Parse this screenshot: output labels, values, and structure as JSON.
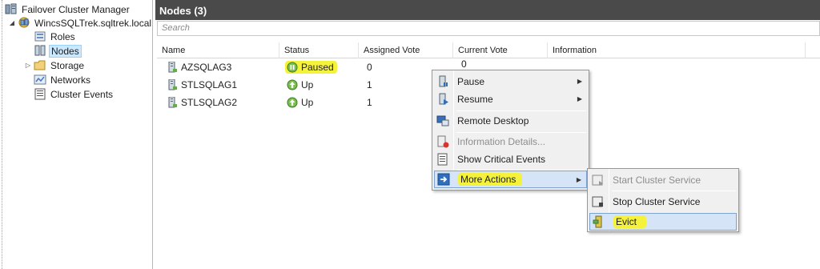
{
  "tree": {
    "root": "Failover Cluster Manager",
    "cluster": "WincsSQLTrek.sqltrek.local",
    "items": [
      "Roles",
      "Nodes",
      "Storage",
      "Networks",
      "Cluster Events"
    ]
  },
  "header": {
    "title": "Nodes (3)"
  },
  "search": {
    "placeholder": "Search"
  },
  "columns": [
    "Name",
    "Status",
    "Assigned Vote",
    "Current Vote",
    "Information"
  ],
  "rows": [
    {
      "name": "AZSQLAG3",
      "status": "Paused",
      "assigned_vote": "0",
      "current_vote": "0"
    },
    {
      "name": "STLSQLAG1",
      "status": "Up",
      "assigned_vote": "1",
      "current_vote": ""
    },
    {
      "name": "STLSQLAG2",
      "status": "Up",
      "assigned_vote": "1",
      "current_vote": ""
    }
  ],
  "context_menu": {
    "items": [
      "Pause",
      "Resume",
      "Remote Desktop",
      "Information Details...",
      "Show Critical Events",
      "More Actions"
    ]
  },
  "submenu": {
    "items": [
      "Start Cluster Service",
      "Stop Cluster Service",
      "Evict"
    ]
  },
  "colors": {
    "highlight": "#f4f23a",
    "header_bg": "#4a4a4a",
    "selection": "#cce8ff",
    "menu_hot": "#d5e5f7"
  }
}
